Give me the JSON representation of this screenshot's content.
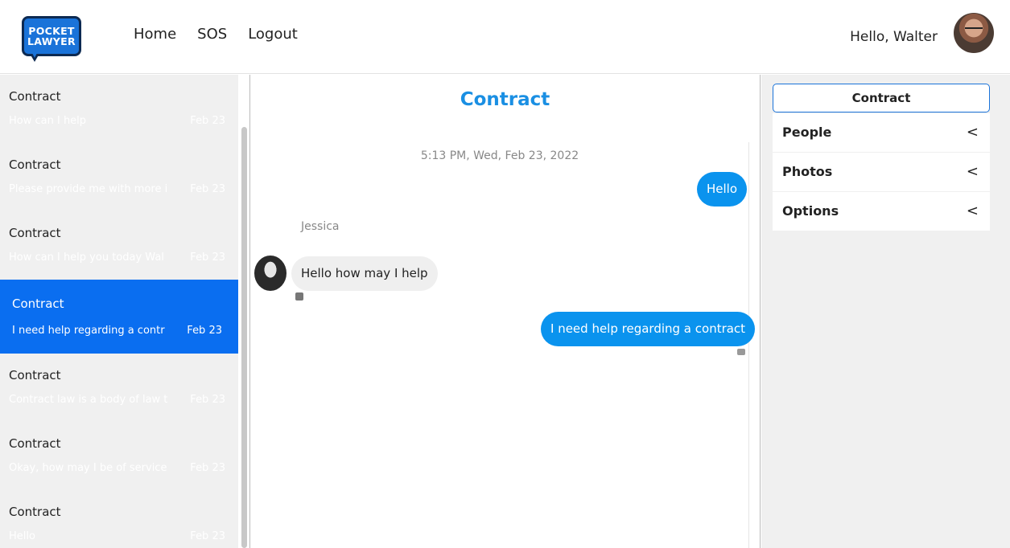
{
  "header": {
    "logo_line1": "POCKET",
    "logo_line2": "LAWYER",
    "nav": [
      "Home",
      "SOS",
      "Logout"
    ],
    "greeting": "Hello, Walter"
  },
  "conversations": [
    {
      "title": "Contract",
      "snippet": "How can I help",
      "date": "Feb 23"
    },
    {
      "title": "Contract",
      "snippet": "Please provide me with more i",
      "date": "Feb 23"
    },
    {
      "title": "Contract",
      "snippet": "How can I help you today Wal",
      "date": "Feb 23"
    },
    {
      "title": "Contract",
      "snippet": "I need help regarding a contr",
      "date": "Feb 23"
    },
    {
      "title": "Contract",
      "snippet": "Contract law is a body of law t",
      "date": "Feb 23"
    },
    {
      "title": "Contract",
      "snippet": "Okay, how may I be of service",
      "date": "Feb 23"
    },
    {
      "title": "Contract",
      "snippet": "Hello",
      "date": "Feb 23"
    }
  ],
  "chat": {
    "title": "Contract",
    "timestamp": "5:13 PM, Wed, Feb 23, 2022",
    "sender_name": "Jessica",
    "messages": [
      {
        "text": "Hello",
        "direction": "out"
      },
      {
        "text": "Hello how may I help",
        "direction": "in"
      },
      {
        "text": "I need help regarding a contract",
        "direction": "out"
      }
    ]
  },
  "panel": {
    "tab": "Contract",
    "items": [
      "People",
      "Photos",
      "Options"
    ],
    "chevron": "<"
  },
  "colors": {
    "accent": "#0a6ef0",
    "bubble_out": "#0a93ee",
    "title": "#1a8fe3"
  }
}
